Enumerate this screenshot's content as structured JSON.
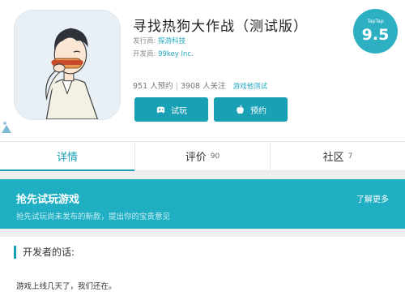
{
  "app": {
    "title": "寻找热狗大作战（测试版）",
    "publisher_label": "发行商:",
    "publisher": "探游科技",
    "developer_label": "开发商:",
    "developer": "99key Inc.",
    "reservations": "951 人预约",
    "followers": "3908 人关注",
    "stats_separator": "|",
    "status_tag": "游戏他测试"
  },
  "rating": {
    "label": "TapTap",
    "score": "9.5"
  },
  "buttons": {
    "try_label": "试玩",
    "reserve_label": "预约"
  },
  "tabs": [
    {
      "label": "详情",
      "count": "",
      "active": true
    },
    {
      "label": "评价",
      "count": "90",
      "active": false
    },
    {
      "label": "社区",
      "count": "7",
      "active": false
    }
  ],
  "banner": {
    "title": "抢先试玩游戏",
    "subtitle": "抢先试玩尚未发布的新款，提出你的宝贵意见",
    "more": "了解更多"
  },
  "developer_note": {
    "heading": "开发者的话:",
    "body": "游戏上线几天了，我们还在。"
  },
  "colors": {
    "accent": "#1aa0b5",
    "banner": "#20aec3",
    "rating": "#2eb0c3"
  }
}
